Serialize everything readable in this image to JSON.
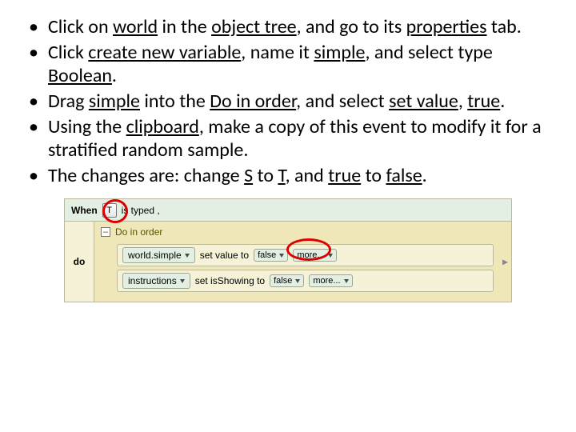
{
  "bullets": [
    {
      "pre": "Click on ",
      "u1": "world",
      "mid1": " in the ",
      "u2": "object tree",
      "mid2": ", and go to its ",
      "u3": "properties",
      "post": " tab."
    },
    {
      "pre": "Click ",
      "u1": "create new variable",
      "mid1": ", name it ",
      "u2": "simple",
      "mid2": ", and select type ",
      "u3": "Boolean",
      "post": "."
    },
    {
      "pre": "Drag ",
      "u1": "simple",
      "mid1": " into the ",
      "u2": "Do in order",
      "mid2": ", and select ",
      "u3": "set value",
      "mid3": ", ",
      "u4": "true",
      "post": "."
    },
    {
      "pre": "Using the ",
      "u1": "clipboard",
      "post": ", make a copy of this event to modify it for a stratified random sample."
    },
    {
      "pre": "The changes are: change ",
      "u1": "S",
      "mid1": " to ",
      "u2": "T",
      "mid2": ", and ",
      "u3": "true",
      "mid3": " to ",
      "u4": "false",
      "post": "."
    }
  ],
  "editor": {
    "when": "When",
    "key": "T",
    "is_typed": "is typed ,",
    "do": "do",
    "toggle": "–",
    "do_in_order": "Do in order",
    "row1": {
      "obj": "world.simple",
      "verb": "set value to",
      "val": "false",
      "more": "more..."
    },
    "row2": {
      "obj": "instructions",
      "verb": "set isShowing to",
      "val": "false",
      "more": "more..."
    }
  }
}
